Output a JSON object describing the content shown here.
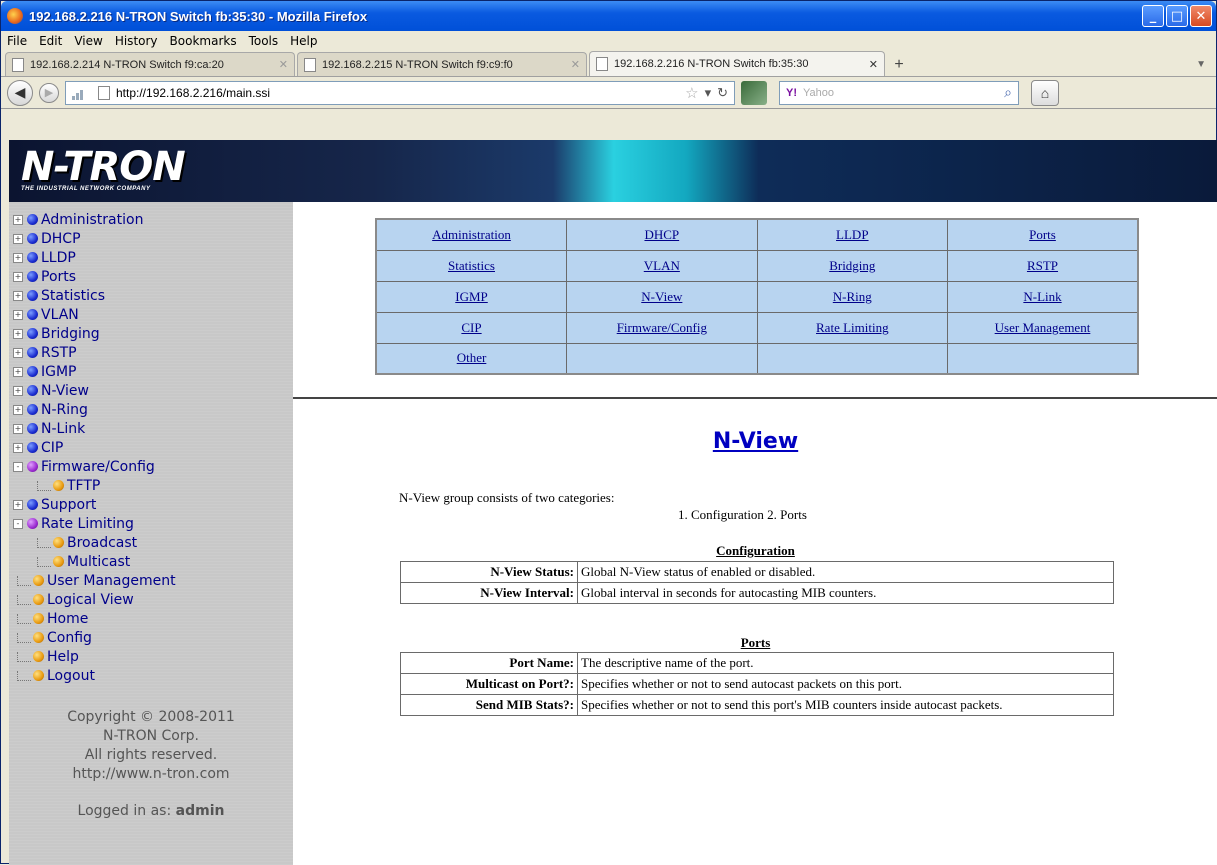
{
  "window": {
    "title": "192.168.2.216 N-TRON Switch fb:35:30 - Mozilla Firefox"
  },
  "menubar": [
    "File",
    "Edit",
    "View",
    "History",
    "Bookmarks",
    "Tools",
    "Help"
  ],
  "tabs": [
    {
      "label": "192.168.2.214 N-TRON Switch f9:ca:20"
    },
    {
      "label": "192.168.2.215 N-TRON Switch f9:c9:f0"
    },
    {
      "label": "192.168.2.216 N-TRON Switch fb:35:30"
    }
  ],
  "navbar": {
    "url": "http://192.168.2.216/main.ssi",
    "search_placeholder": "Yahoo",
    "search_engine": "Y!"
  },
  "banner": {
    "logo": "N-TRON",
    "tagline": "THE INDUSTRIAL NETWORK COMPANY"
  },
  "sidebar": {
    "items": [
      {
        "label": "Administration",
        "exp": "+",
        "dot": "blue",
        "level": 0
      },
      {
        "label": "DHCP",
        "exp": "+",
        "dot": "blue",
        "level": 0
      },
      {
        "label": "LLDP",
        "exp": "+",
        "dot": "blue",
        "level": 0
      },
      {
        "label": "Ports",
        "exp": "+",
        "dot": "blue",
        "level": 0
      },
      {
        "label": "Statistics",
        "exp": "+",
        "dot": "blue",
        "level": 0
      },
      {
        "label": "VLAN",
        "exp": "+",
        "dot": "blue",
        "level": 0
      },
      {
        "label": "Bridging",
        "exp": "+",
        "dot": "blue",
        "level": 0
      },
      {
        "label": "RSTP",
        "exp": "+",
        "dot": "blue",
        "level": 0
      },
      {
        "label": "IGMP",
        "exp": "+",
        "dot": "blue",
        "level": 0
      },
      {
        "label": "N-View",
        "exp": "+",
        "dot": "blue",
        "level": 0
      },
      {
        "label": "N-Ring",
        "exp": "+",
        "dot": "blue",
        "level": 0
      },
      {
        "label": "N-Link",
        "exp": "+",
        "dot": "blue",
        "level": 0
      },
      {
        "label": "CIP",
        "exp": "+",
        "dot": "blue",
        "level": 0
      },
      {
        "label": "Firmware/Config",
        "exp": "-",
        "dot": "purple",
        "level": 0
      },
      {
        "label": "TFTP",
        "exp": "",
        "dot": "orange",
        "level": 1
      },
      {
        "label": "Support",
        "exp": "+",
        "dot": "blue",
        "level": 0
      },
      {
        "label": "Rate Limiting",
        "exp": "-",
        "dot": "purple",
        "level": 0
      },
      {
        "label": "Broadcast",
        "exp": "",
        "dot": "orange",
        "level": 1
      },
      {
        "label": "Multicast",
        "exp": "",
        "dot": "orange",
        "level": 1
      },
      {
        "label": "User Management",
        "exp": "",
        "dot": "orange",
        "level": 0
      },
      {
        "label": "Logical View",
        "exp": "",
        "dot": "orange",
        "level": 0
      },
      {
        "label": "Home",
        "exp": "",
        "dot": "orange",
        "level": 0
      },
      {
        "label": "Config",
        "exp": "",
        "dot": "orange",
        "level": 0
      },
      {
        "label": "Help",
        "exp": "",
        "dot": "orange",
        "level": 0
      },
      {
        "label": "Logout",
        "exp": "",
        "dot": "orange",
        "level": 0
      }
    ],
    "copyright_line1": "Copyright © 2008-2011",
    "copyright_line2": "N-TRON Corp.",
    "copyright_line3": "All rights reserved.",
    "copyright_line4": "http://www.n-tron.com",
    "logged_prefix": "Logged in as: ",
    "logged_user": "admin"
  },
  "nav_grid": [
    [
      "Administration",
      "DHCP",
      "LLDP",
      "Ports"
    ],
    [
      "Statistics",
      "VLAN",
      "Bridging",
      "RSTP"
    ],
    [
      "IGMP",
      "N-View",
      "N-Ring",
      "N-Link"
    ],
    [
      "CIP",
      "Firmware/Config",
      "Rate Limiting",
      "User Management"
    ],
    [
      "Other",
      "",
      "",
      ""
    ]
  ],
  "page": {
    "heading": "N-View",
    "intro": "N-View group consists of two categories:",
    "categories": "1. Configuration  2. Ports",
    "config_title": "Configuration",
    "config_rows": [
      {
        "k": "N-View Status:",
        "v": "Global N-View status of enabled or disabled."
      },
      {
        "k": "N-View Interval:",
        "v": "Global interval in seconds for autocasting MIB counters."
      }
    ],
    "ports_title": "Ports",
    "ports_rows": [
      {
        "k": "Port Name:",
        "v": "The descriptive name of the port."
      },
      {
        "k": "Multicast on Port?:",
        "v": "Specifies whether or not to send autocast packets on this port."
      },
      {
        "k": "Send MIB Stats?:",
        "v": "Specifies whether or not to send this port's MIB counters inside autocast packets."
      }
    ]
  }
}
